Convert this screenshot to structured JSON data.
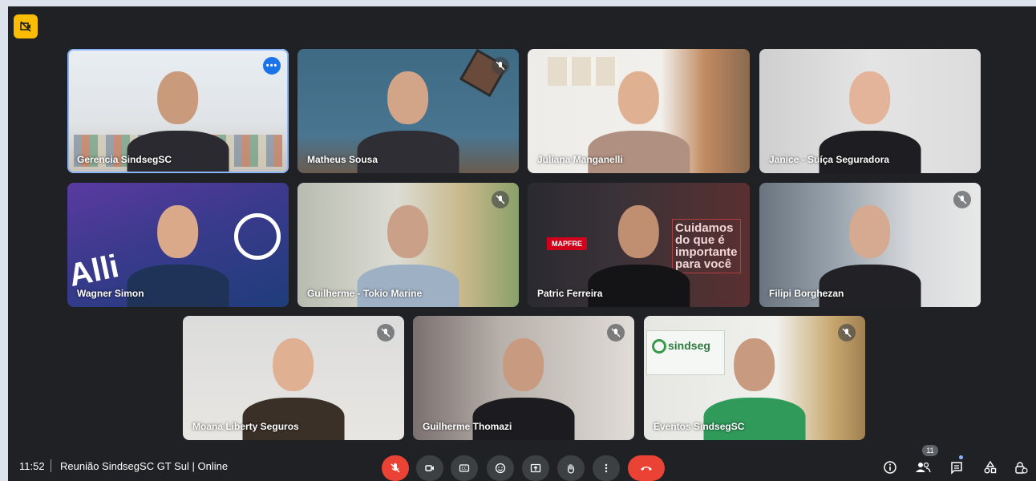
{
  "meeting": {
    "time": "11:52",
    "title": "Reunião SindsegSC GT Sul | Online",
    "participant_count": "11"
  },
  "icons": {
    "corner_badge": "video-off-icon",
    "controls": [
      "mic-off-icon",
      "camera-icon",
      "captions-icon",
      "emoji-icon",
      "present-icon",
      "raise-hand-icon",
      "more-options-icon",
      "hangup-icon"
    ],
    "right": [
      "info-icon",
      "people-icon",
      "chat-icon",
      "activities-icon",
      "host-controls-icon"
    ]
  },
  "colors": {
    "background": "#202124",
    "control": "#3c4043",
    "danger": "#ea4335",
    "accent": "#1a73e8",
    "badge_yellow": "#fbbc04"
  },
  "participants": [
    {
      "name": "Gerencia SindsegSC",
      "muted": false,
      "speaking": true
    },
    {
      "name": "Matheus Sousa",
      "muted": true
    },
    {
      "name": "Juliana Manganelli",
      "muted": false
    },
    {
      "name": "Janice - Suíça Seguradora",
      "muted": false
    },
    {
      "name": "Wagner Simon",
      "muted": false
    },
    {
      "name": "Guilherme - Tokio Marine",
      "muted": true
    },
    {
      "name": "Patric Ferreira",
      "muted": false
    },
    {
      "name": "Filipi Borghezan",
      "muted": true
    },
    {
      "name": "Moana Liberty Seguros",
      "muted": true
    },
    {
      "name": "Guilherme Thomazi",
      "muted": true
    },
    {
      "name": "Eventos SindsegSC",
      "muted": true
    }
  ],
  "backgrounds": {
    "mapfre_logo": "MAPFRE",
    "slogan": "Cuidamos do que é importante para você",
    "sindseg_sign": "sindseg",
    "allianz_text": "Alli"
  }
}
